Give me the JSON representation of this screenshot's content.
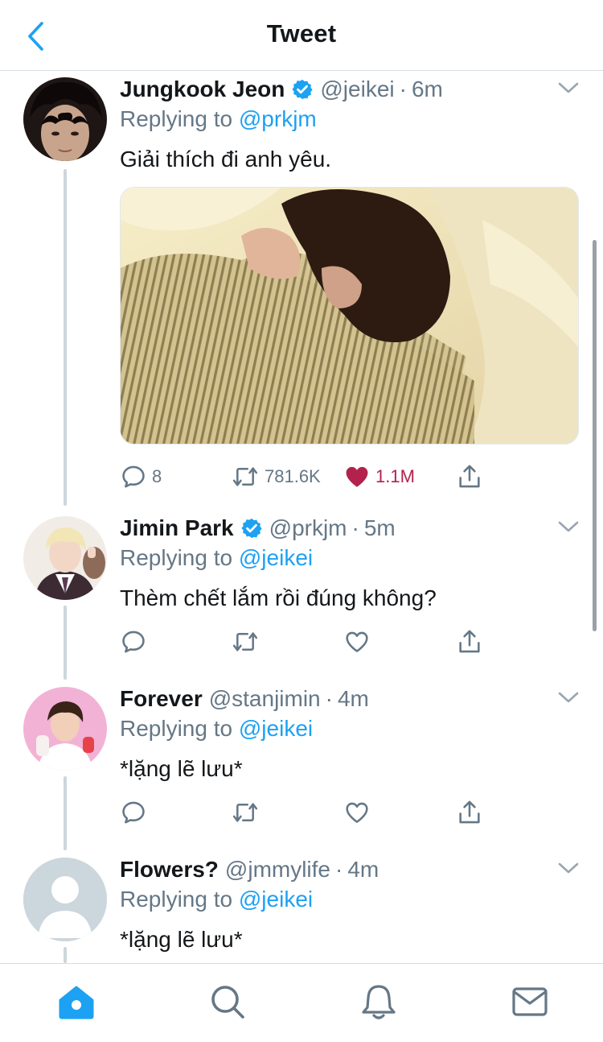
{
  "header": {
    "title": "Tweet",
    "back_icon": "chevron-left-icon"
  },
  "colors": {
    "accent": "#1da1f2",
    "secondary_text": "#657786",
    "like": "#b3224d",
    "divider": "#d8dde2"
  },
  "tweets": [
    {
      "name": "Jungkook Jeon",
      "verified": true,
      "handle": "@jeikei",
      "time": "6m",
      "replying_prefix": "Replying to ",
      "replying_to": "@prkjm",
      "text": "Giải thích đi anh yêu.",
      "has_media": true,
      "replies": "8",
      "retweets": "781.6K",
      "likes": "1.1M",
      "liked": true
    },
    {
      "name": "Jimin Park",
      "verified": true,
      "handle": "@prkjm",
      "time": "5m",
      "replying_prefix": "Replying to ",
      "replying_to": "@jeikei",
      "text": "Thèm chết lắm rồi đúng không?"
    },
    {
      "name": "Forever",
      "verified": false,
      "handle": "@stanjimin",
      "time": "4m",
      "replying_prefix": "Replying to ",
      "replying_to": "@jeikei",
      "text": "*lặng lẽ lưu*"
    },
    {
      "name": "Flowers?",
      "verified": false,
      "handle": "@jmmylife",
      "time": "4m",
      "replying_prefix": "Replying to ",
      "replying_to": "@jeikei",
      "text": "*lặng lẽ lưu*"
    }
  ],
  "dot": "·",
  "tabbar": {
    "items": [
      "home-icon",
      "search-icon",
      "notifications-icon",
      "messages-icon"
    ],
    "active": "home"
  }
}
